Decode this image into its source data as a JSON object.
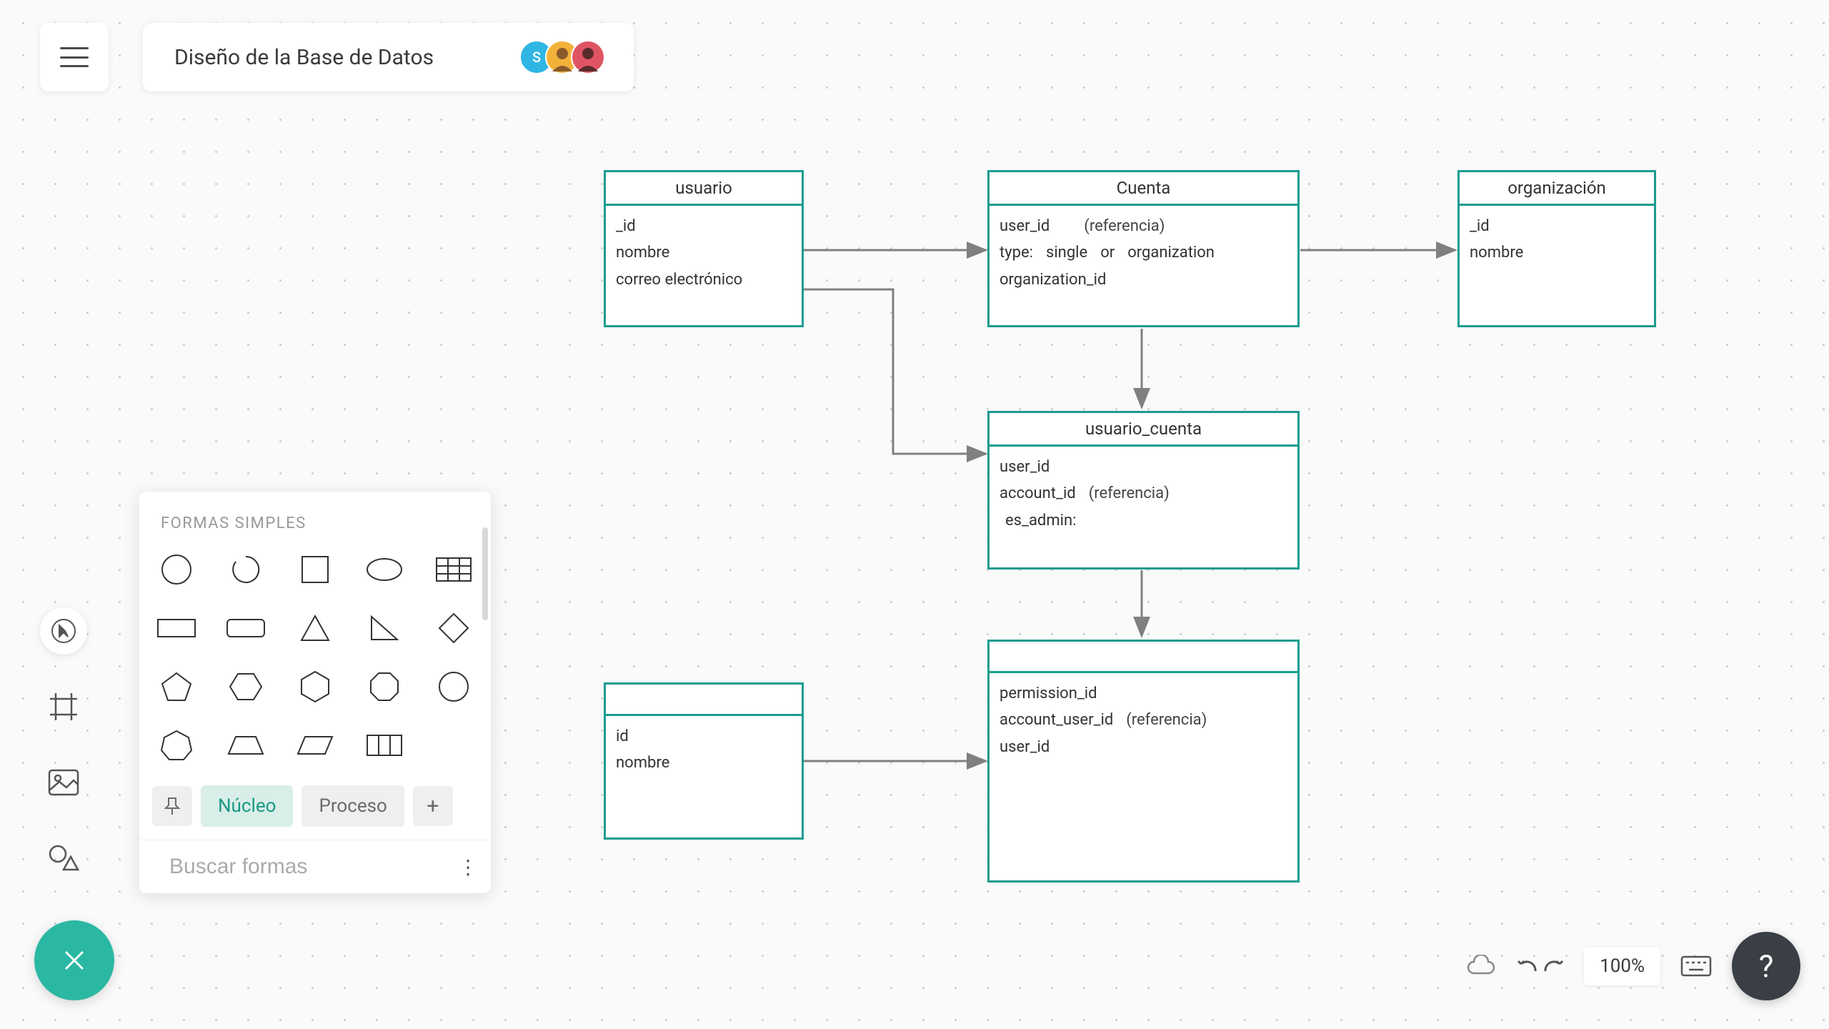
{
  "header": {
    "title": "Diseño de la Base de Datos",
    "avatars": [
      {
        "initial": "S",
        "bg": "#2fb6e4"
      },
      {
        "initial": "",
        "bg": "#f2b23a"
      },
      {
        "initial": "",
        "bg": "#e05563"
      }
    ]
  },
  "shapes_panel": {
    "section_label": "FORMAS SIMPLES",
    "tabs": {
      "active": "Núcleo",
      "inactive": "Proceso"
    },
    "search_placeholder": "Buscar formas"
  },
  "entities": {
    "usuario": {
      "title": "usuario",
      "fields": [
        "_id",
        "nombre",
        "correo electrónico"
      ]
    },
    "cuenta": {
      "title": "Cuenta",
      "row1_a": "user_id",
      "row1_b": "(referencia)",
      "row2_a": "type:",
      "row2_b": "single",
      "row2_c": "or",
      "row2_d": "organization",
      "row3": "organization_id"
    },
    "organizacion": {
      "title": "organización",
      "fields": [
        "_id",
        "nombre"
      ]
    },
    "usuario_cuenta": {
      "title": "usuario_cuenta",
      "row1": "user_id",
      "row2_a": "account_id",
      "row2_b": "(referencia)",
      "row3": "es_admin:"
    },
    "permiso_box": {
      "row1": "permission_id",
      "row2_a": "account_user_id",
      "row2_b": "(referencia)",
      "row3": "user_id"
    },
    "bottom_left": {
      "fields": [
        "id",
        "nombre"
      ]
    }
  },
  "footer": {
    "zoom": "100%",
    "help": "?"
  }
}
